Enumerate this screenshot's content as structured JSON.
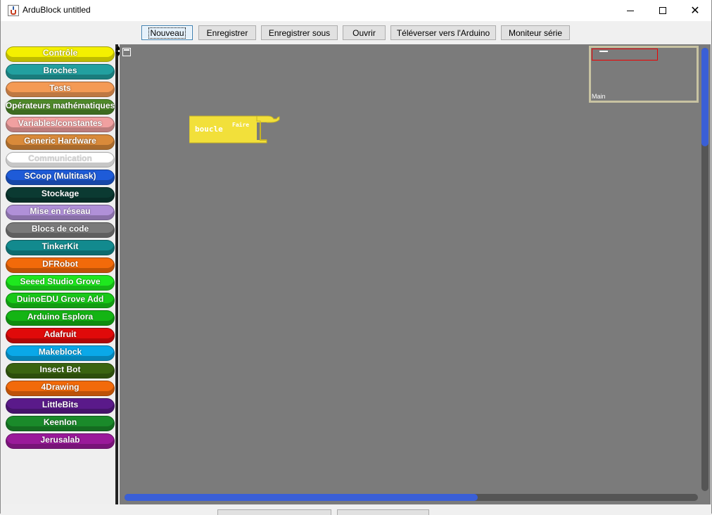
{
  "window": {
    "title": "ArduBlock untitled",
    "icon": "java-cup-icon",
    "controls": {
      "minimize": "minimize-icon",
      "maximize": "maximize-icon",
      "close": "✕"
    }
  },
  "toolbar": {
    "buttons": [
      {
        "label": "Nouveau",
        "active": true
      },
      {
        "label": "Enregistrer"
      },
      {
        "label": "Enregistrer sous"
      },
      {
        "label": "Ouvrir"
      },
      {
        "label": "Téléverser vers l'Arduino"
      },
      {
        "label": "Moniteur série"
      }
    ]
  },
  "palette": {
    "categories": [
      {
        "label": "Contrôle",
        "color": "#f4f000",
        "text": "#ffffff"
      },
      {
        "label": "Broches",
        "color": "#22a0a0",
        "text": "#ffffff"
      },
      {
        "label": "Tests",
        "color": "#f49a55",
        "text": "#ffffff"
      },
      {
        "label": "Opérateurs mathématiques",
        "color": "#4f8a2a",
        "text": "#ffffff"
      },
      {
        "label": "Variables/constantes",
        "color": "#f0a0a0",
        "text": "#ffffff"
      },
      {
        "label": "Generic Hardware",
        "color": "#d98a3a",
        "text": "#ffffff"
      },
      {
        "label": "Communication",
        "color": "#ffffff",
        "text": "#d0d0d0"
      },
      {
        "label": "SCoop (Multitask)",
        "color": "#1e5bd8",
        "text": "#ffffff"
      },
      {
        "label": "Stockage",
        "color": "#0b3a32",
        "text": "#ffffff"
      },
      {
        "label": "Mise en réseau",
        "color": "#b090d8",
        "text": "#ffffff"
      },
      {
        "label": "Blocs de code",
        "color": "#7a7a7a",
        "text": "#ffffff"
      },
      {
        "label": "TinkerKit",
        "color": "#128a8e",
        "text": "#ffffff"
      },
      {
        "label": "DFRobot",
        "color": "#f26a0a",
        "text": "#ffffff"
      },
      {
        "label": "Seeed Studio Grove",
        "color": "#1ee81e",
        "text": "#ffffff"
      },
      {
        "label": "DuinoEDU Grove Add",
        "color": "#18c818",
        "text": "#ffffff"
      },
      {
        "label": "Arduino Esplora",
        "color": "#14b414",
        "text": "#ffffff"
      },
      {
        "label": "Adafruit",
        "color": "#e00a0a",
        "text": "#ffffff"
      },
      {
        "label": "Makeblock",
        "color": "#0aa8e8",
        "text": "#ffffff"
      },
      {
        "label": "Insect Bot",
        "color": "#3a6410",
        "text": "#ffffff"
      },
      {
        "label": "4Drawing",
        "color": "#f26a0a",
        "text": "#ffffff"
      },
      {
        "label": "LittleBits",
        "color": "#5a1a8a",
        "text": "#ffffff"
      },
      {
        "label": "KeenIon",
        "color": "#1a8a2a",
        "text": "#ffffff"
      },
      {
        "label": "Jerusalab",
        "color": "#9a1a9a",
        "text": "#ffffff"
      }
    ]
  },
  "canvas": {
    "background": "#7b7b7b",
    "block": {
      "name": "boucle",
      "socket_label": "Faire",
      "color": "#f2e03a"
    },
    "minimap": {
      "label": "Main"
    },
    "scroll": {
      "vertical_position": 0,
      "horizontal_fraction": 0.62
    }
  }
}
